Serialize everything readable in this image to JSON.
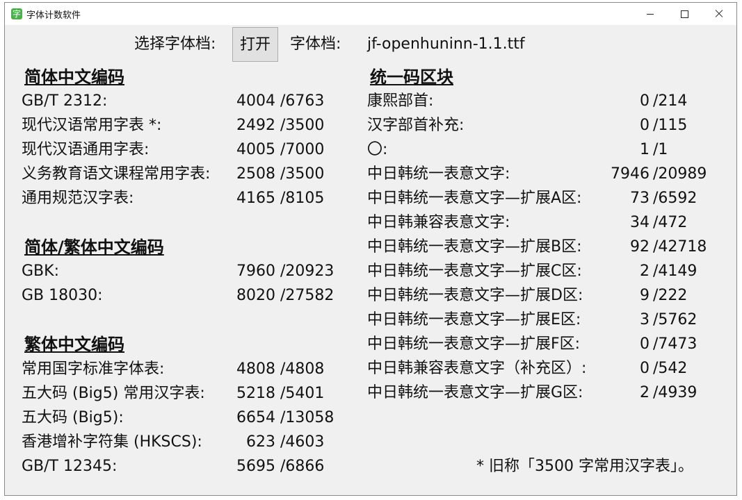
{
  "window": {
    "title": "字体计数软件",
    "icon": "app-icon"
  },
  "toolbar": {
    "choose_label": "选择字体档:",
    "open_button": "打开",
    "file_label": "字体档:",
    "file_name": "jf-openhuninn-1.1.ttf"
  },
  "left": {
    "simplified": {
      "heading": "简体中文编码",
      "rows": [
        {
          "label": "GB/T 2312:",
          "count": "4004",
          "total": "/6763"
        },
        {
          "label": "现代汉语常用字表 *:",
          "count": "2492",
          "total": "/3500"
        },
        {
          "label": "现代汉语通用字表:",
          "count": "4005",
          "total": "/7000"
        },
        {
          "label": "义务教育语文课程常用字表:",
          "count": "2508",
          "total": "/3500"
        },
        {
          "label": "通用规范汉字表:",
          "count": "4165",
          "total": "/8105"
        }
      ]
    },
    "mixed": {
      "heading": "简体/繁体中文编码",
      "rows": [
        {
          "label": "GBK:",
          "count": "7960",
          "total": "/20923"
        },
        {
          "label": "GB 18030:",
          "count": "8020",
          "total": "/27582"
        }
      ]
    },
    "traditional": {
      "heading": "繁体中文编码",
      "rows": [
        {
          "label": "常用国字标准字体表:",
          "count": "4808",
          "total": "/4808"
        },
        {
          "label": "五大码 (Big5) 常用汉字表:",
          "count": "5218",
          "total": "/5401"
        },
        {
          "label": "五大码 (Big5):",
          "count": "6654",
          "total": "/13058"
        },
        {
          "label": "香港增补字符集 (HKSCS):",
          "count": "623",
          "total": "/4603"
        },
        {
          "label": "GB/T 12345:",
          "count": "5695",
          "total": "/6866"
        }
      ]
    }
  },
  "right": {
    "heading": "统一码区块",
    "rows": [
      {
        "label": "康熙部首:",
        "count": "0",
        "total": "/214"
      },
      {
        "label": "汉字部首补充:",
        "count": "0",
        "total": "/115"
      },
      {
        "label": "〇:",
        "count": "1",
        "total": "/1"
      },
      {
        "label": "中日韩统一表意文字:",
        "count": "7946",
        "total": "/20989"
      },
      {
        "label": "中日韩统一表意文字—扩展A区:",
        "count": "73",
        "total": "/6592"
      },
      {
        "label": "中日韩兼容表意文字:",
        "count": "34",
        "total": "/472"
      },
      {
        "label": "中日韩统一表意文字—扩展B区:",
        "count": "92",
        "total": "/42718"
      },
      {
        "label": "中日韩统一表意文字—扩展C区:",
        "count": "2",
        "total": "/4149"
      },
      {
        "label": "中日韩统一表意文字—扩展D区:",
        "count": "9",
        "total": "/222"
      },
      {
        "label": "中日韩统一表意文字—扩展E区:",
        "count": "3",
        "total": "/5762"
      },
      {
        "label": "中日韩统一表意文字—扩展F区:",
        "count": "0",
        "total": "/7473"
      },
      {
        "label": "中日韩兼容表意文字（补充区）:",
        "count": "0",
        "total": "/542"
      },
      {
        "label": "中日韩统一表意文字—扩展G区:",
        "count": "2",
        "total": "/4939"
      }
    ]
  },
  "footnote": "* 旧称「3500 字常用汉字表」。"
}
